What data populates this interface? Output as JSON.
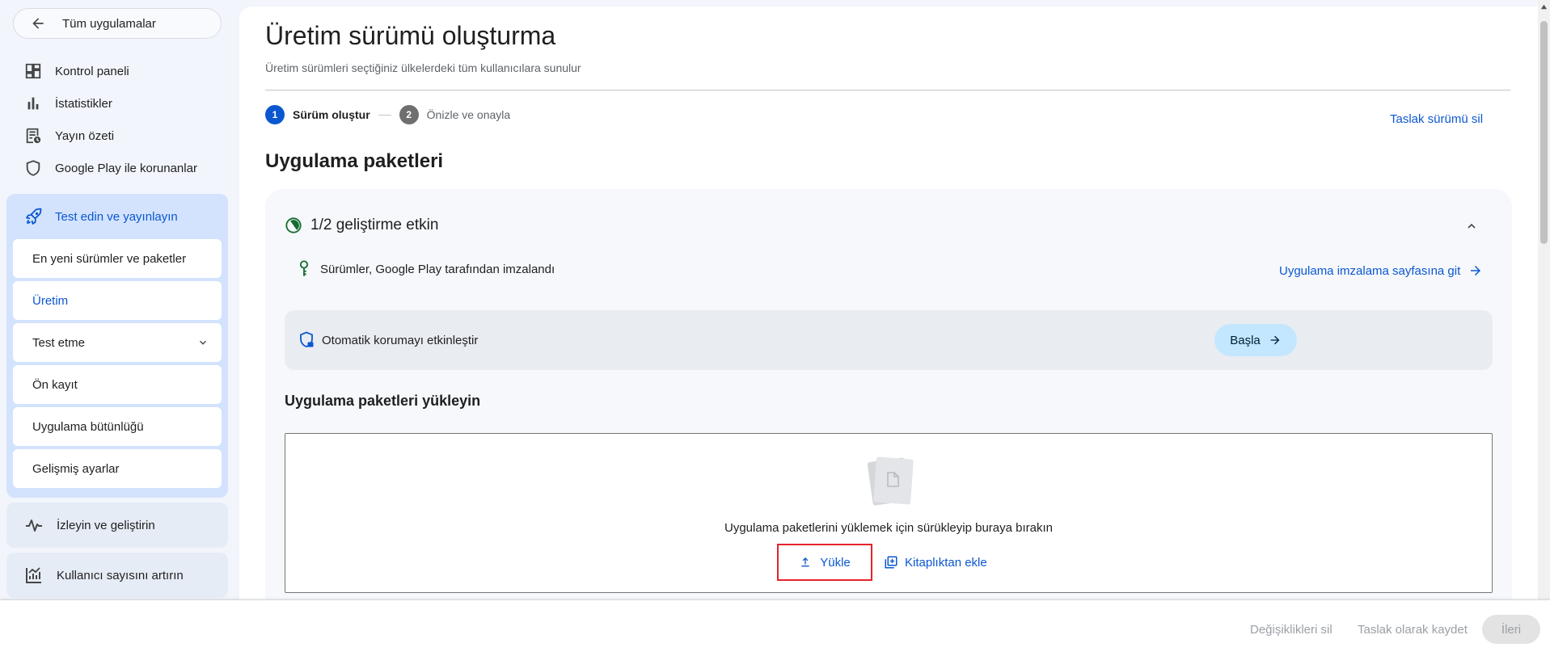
{
  "sidebar": {
    "back_label": "Tüm uygulamalar",
    "items": [
      {
        "label": "Kontrol paneli",
        "icon": "dashboard-icon"
      },
      {
        "label": "İstatistikler",
        "icon": "bar-chart-icon"
      },
      {
        "label": "Yayın özeti",
        "icon": "publishing-overview-icon"
      },
      {
        "label": "Google Play ile korunanlar",
        "icon": "shield-icon"
      }
    ],
    "group": {
      "label": "Test edin ve yayınlayın",
      "icon": "rocket-icon",
      "sub_items": [
        {
          "label": "En yeni sürümler ve paketler"
        },
        {
          "label": "Üretim"
        },
        {
          "label": "Test etme"
        },
        {
          "label": "Ön kayıt"
        },
        {
          "label": "Uygulama bütünlüğü"
        },
        {
          "label": "Gelişmiş ayarlar"
        }
      ],
      "active_item": "Üretim"
    },
    "blocks": [
      {
        "label": "İzleyin ve geliştirin",
        "icon": "pulse-icon"
      },
      {
        "label": "Kullanıcı sayısını artırın",
        "icon": "growth-chart-icon"
      }
    ]
  },
  "main": {
    "title": "Üretim sürümü oluşturma",
    "subtitle": "Üretim sürümleri seçtiğiniz ülkelerdeki tüm kullanıcılara sunulur",
    "steps": [
      {
        "number": "1",
        "label": "Sürüm oluştur",
        "active": true
      },
      {
        "number": "2",
        "label": "Önizle ve onayla",
        "active": false
      }
    ],
    "discard_label": "Taslak sürümü sil",
    "section_title": "Uygulama paketleri",
    "card": {
      "header": "1/2 geliştirme etkin",
      "signed_text": "Sürümler, Google Play tarafından imzalandı",
      "signing_link": "Uygulama imzalama sayfasına git",
      "protection_label": "Otomatik korumayı etkinleştir",
      "start_label": "Başla",
      "upload_title": "Uygulama paketleri yükleyin",
      "drop_text": "Uygulama paketlerini yüklemek için sürükleyip buraya bırakın",
      "upload_label": "Yükle",
      "library_label": "Kitaplıktan ekle"
    }
  },
  "footer": {
    "discard_changes": "Değişiklikleri sil",
    "save_draft": "Taslak olarak kaydet",
    "next": "İleri"
  },
  "colors": {
    "accent": "#0b57d0",
    "group_bg": "#d3e3fd",
    "highlight_border": "#e3242b",
    "start_button_bg": "#c2e7ff"
  }
}
